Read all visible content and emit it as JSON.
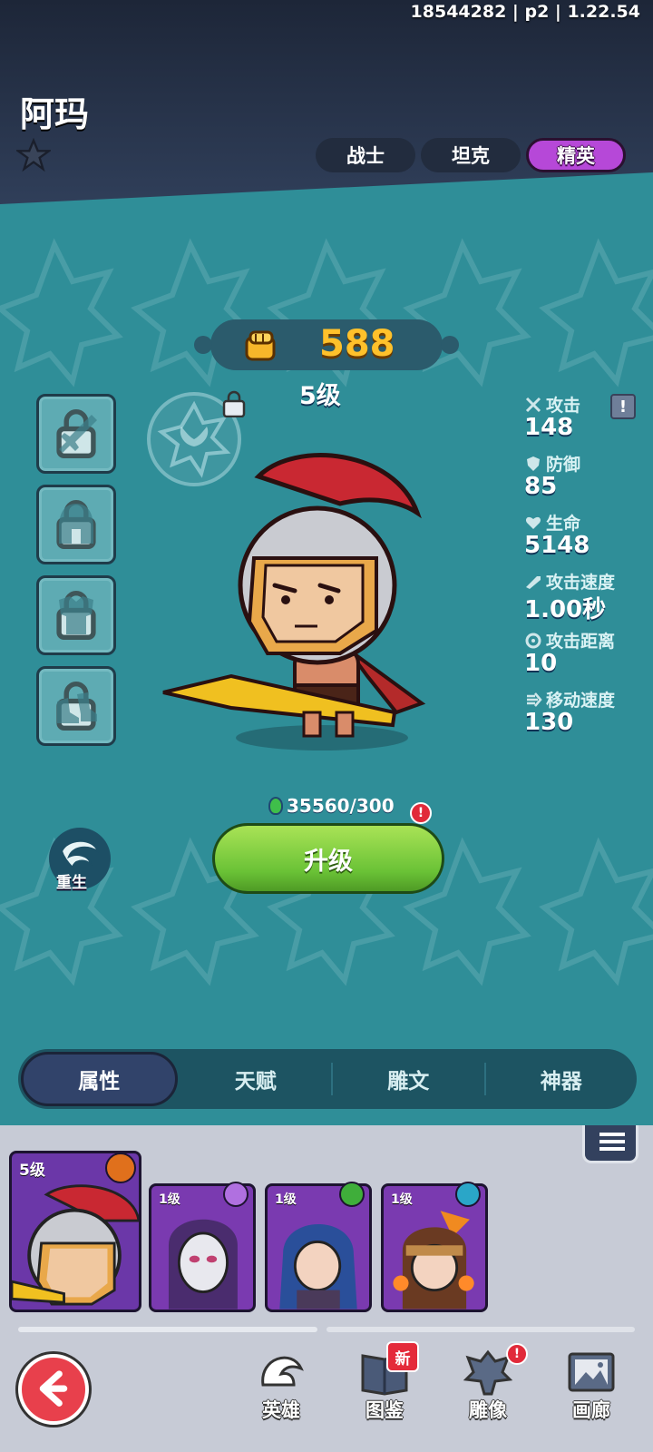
{
  "build_info": "18544282 | p2 | 1.22.54",
  "hero": {
    "name": "阿玛",
    "power": "588",
    "level": "5级"
  },
  "class_tabs": [
    {
      "label": "战士",
      "active": false
    },
    {
      "label": "坦克",
      "active": false
    },
    {
      "label": "精英",
      "active": true
    }
  ],
  "stats": [
    {
      "label": "攻击",
      "value": "148",
      "icon": "sword-icon"
    },
    {
      "label": "防御",
      "value": "85",
      "icon": "shield-icon"
    },
    {
      "label": "生命",
      "value": "5148",
      "icon": "heart-icon"
    },
    {
      "label": "攻击速度",
      "value": "1.00秒",
      "icon": "attack-speed-icon"
    },
    {
      "label": "攻击距离",
      "value": "10",
      "icon": "range-icon"
    },
    {
      "label": "移动速度",
      "value": "130",
      "icon": "move-speed-icon"
    }
  ],
  "info_label": "!",
  "upgrade": {
    "cost": "35560/300",
    "label": "升级",
    "badge": "!"
  },
  "rebirth_label": "重生",
  "detail_tabs": [
    {
      "label": "属性",
      "active": true
    },
    {
      "label": "天赋",
      "active": false
    },
    {
      "label": "雕文",
      "active": false
    },
    {
      "label": "神器",
      "active": false
    }
  ],
  "roster": [
    {
      "level": "5级",
      "type_color": "#e0701c"
    },
    {
      "level": "1级",
      "type_color": "#b070e0"
    },
    {
      "level": "1级",
      "type_color": "#3fae3a"
    },
    {
      "level": "1级",
      "type_color": "#2aa6c8"
    }
  ],
  "nav": {
    "heroes": "英雄",
    "codex": "图鉴",
    "codex_badge": "新",
    "statues": "雕像",
    "statues_badge": "!",
    "gallery": "画廊"
  },
  "colors": {
    "accent_purple": "#b648d8",
    "upgrade_green": "#6ac236",
    "power_gold": "#ffc12b",
    "alert_red": "#e12a3a"
  }
}
